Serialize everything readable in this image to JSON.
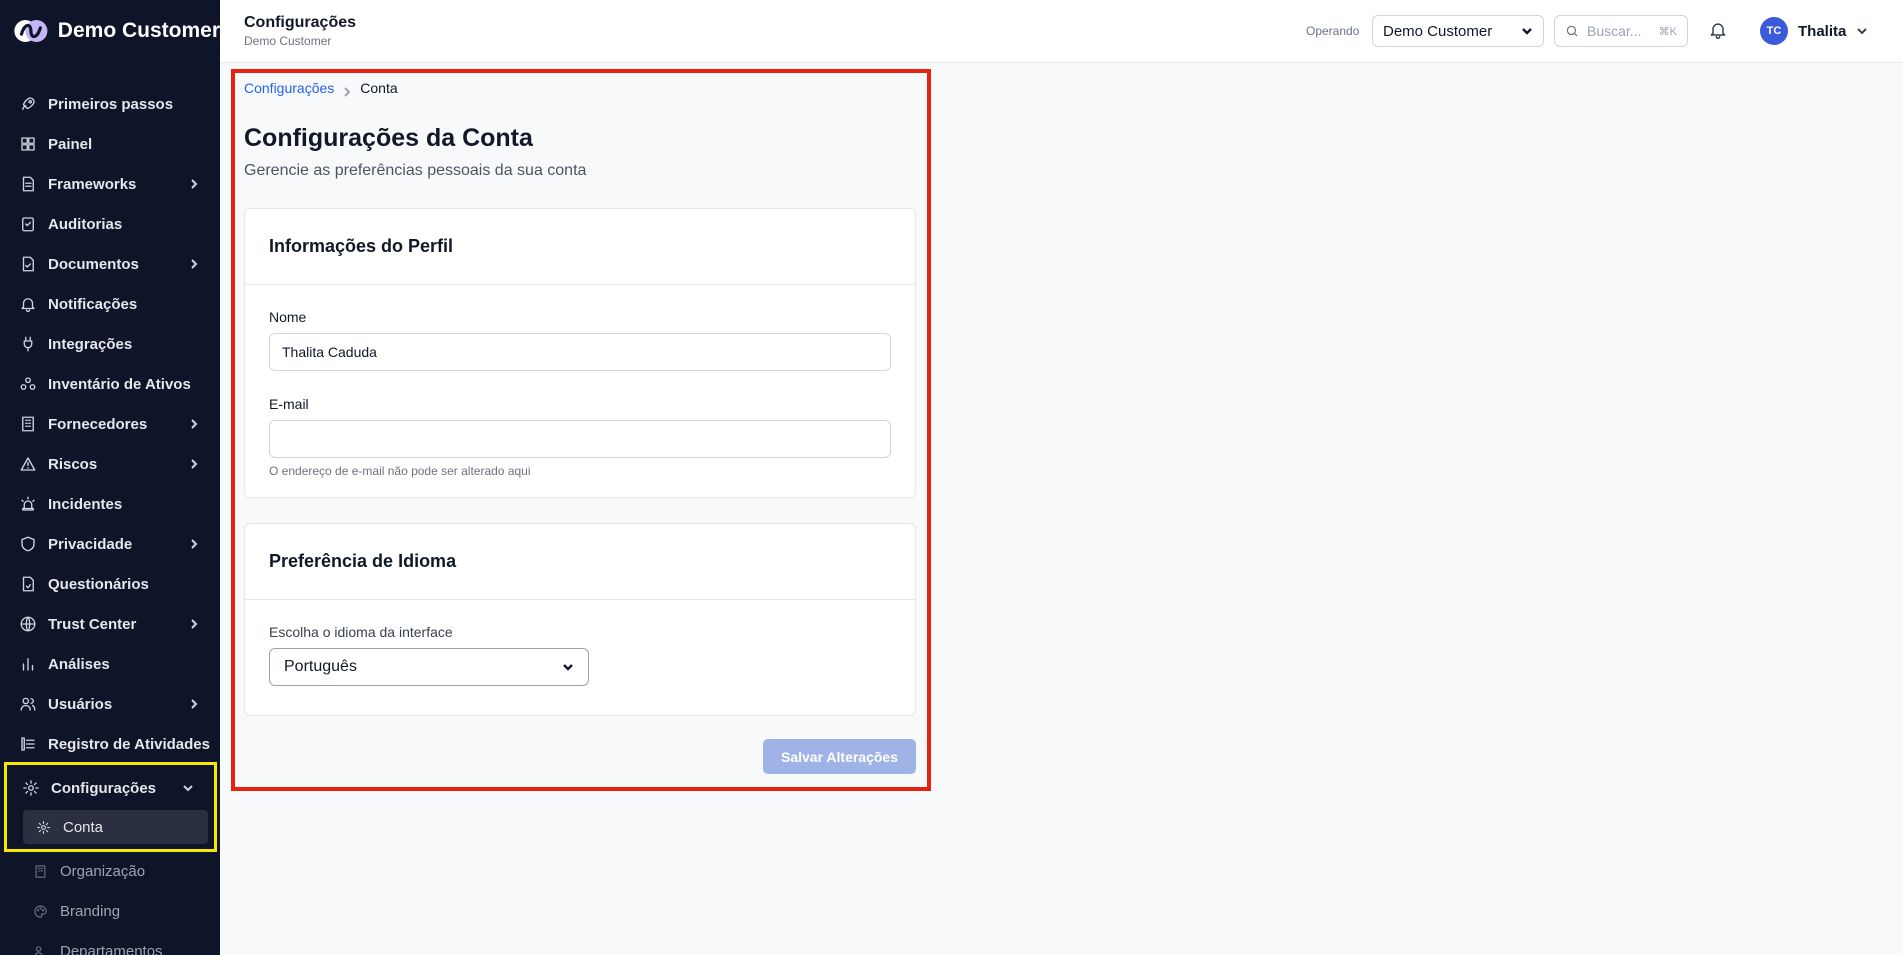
{
  "brand": {
    "name": "Demo Customer"
  },
  "sidebar": {
    "items": [
      {
        "label": "Primeiros passos",
        "icon": "rocket-icon",
        "has_children": false
      },
      {
        "label": "Painel",
        "icon": "dashboard-icon",
        "has_children": false
      },
      {
        "label": "Frameworks",
        "icon": "document-icon",
        "has_children": true
      },
      {
        "label": "Auditorias",
        "icon": "clipboard-check-icon",
        "has_children": false
      },
      {
        "label": "Documentos",
        "icon": "file-check-icon",
        "has_children": true
      },
      {
        "label": "Notificações",
        "icon": "bell-icon",
        "has_children": false
      },
      {
        "label": "Integrações",
        "icon": "plug-icon",
        "has_children": false
      },
      {
        "label": "Inventário de Ativos",
        "icon": "assets-icon",
        "has_children": false
      },
      {
        "label": "Fornecedores",
        "icon": "building-icon",
        "has_children": true
      },
      {
        "label": "Riscos",
        "icon": "warning-icon",
        "has_children": true
      },
      {
        "label": "Incidentes",
        "icon": "siren-icon",
        "has_children": false
      },
      {
        "label": "Privacidade",
        "icon": "shield-icon",
        "has_children": true
      },
      {
        "label": "Questionários",
        "icon": "questionnaire-icon",
        "has_children": false
      },
      {
        "label": "Trust Center",
        "icon": "globe-icon",
        "has_children": true
      },
      {
        "label": "Análises",
        "icon": "bar-chart-icon",
        "has_children": false
      },
      {
        "label": "Usuários",
        "icon": "users-icon",
        "has_children": true
      },
      {
        "label": "Registro de Atividades",
        "icon": "activity-log-icon",
        "has_children": false
      }
    ],
    "config": {
      "label": "Configurações",
      "icon": "gear-icon",
      "sub_items": [
        {
          "label": "Conta",
          "icon": "gear-icon",
          "active": true
        },
        {
          "label": "Organização",
          "icon": "building-icon",
          "active": false
        },
        {
          "label": "Branding",
          "icon": "palette-icon",
          "active": false
        },
        {
          "label": "Departamentos",
          "icon": "users-icon",
          "active": false
        }
      ]
    }
  },
  "header": {
    "title": "Configurações",
    "subtitle": "Demo Customer",
    "operando_label": "Operando",
    "org_selected": "Demo Customer",
    "search_placeholder": "Buscar...",
    "search_shortcut": "⌘K",
    "user_initials": "TC",
    "user_name": "Thalita"
  },
  "breadcrumb": {
    "parent": "Configurações",
    "current": "Conta"
  },
  "page": {
    "title": "Configurações da Conta",
    "description": "Gerencie as preferências pessoais da sua conta"
  },
  "profile": {
    "heading": "Informações do Perfil",
    "name_label": "Nome",
    "name_value": "Thalita Caduda",
    "email_label": "E-mail",
    "email_value": "",
    "email_help": "O endereço de e-mail não pode ser alterado aqui"
  },
  "language": {
    "heading": "Preferência de Idioma",
    "label": "Escolha o idioma da interface",
    "selected": "Português"
  },
  "actions": {
    "save_label": "Salvar Alterações"
  },
  "colors": {
    "sidebar_bg": "#0f1528",
    "accent": "#2563eb",
    "save_disabled": "#9fb3e6",
    "highlight_red": "#e8220f",
    "highlight_yellow": "#f6e800",
    "avatar": "#3b5bdb"
  }
}
